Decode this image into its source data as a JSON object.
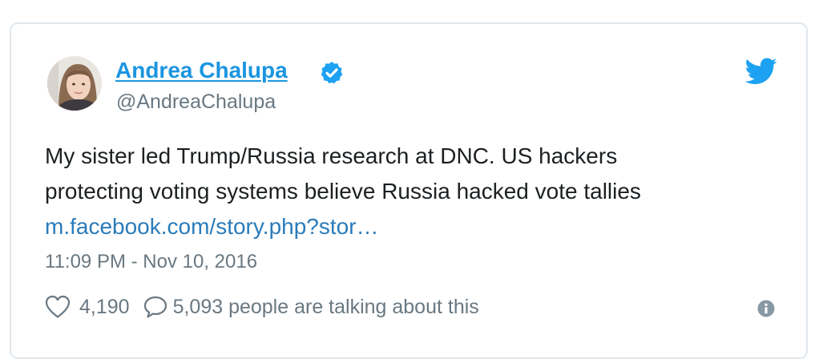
{
  "tweet": {
    "display_name": "Andrea Chalupa",
    "handle": "@AndreaChalupa",
    "text_line_1": "My sister led Trump/Russia research at DNC. US hackers",
    "text_line_2": "protecting voting systems believe Russia hacked vote tallies",
    "link_text": "m.facebook.com/story.php?stor…",
    "timestamp": "11:09 PM - Nov 10, 2016",
    "like_count": "4,190",
    "talking_text": "5,093 people are talking about this"
  },
  "icons": {
    "avatar": "profile-photo",
    "verified": "verified-badge-icon",
    "brand": "twitter-bird-icon",
    "like": "heart-icon",
    "reply": "speech-bubble-icon",
    "info": "info-icon"
  },
  "colors": {
    "accent": "#1b95e0",
    "link": "#2b7bb9",
    "text": "#1c2022",
    "muted": "#697882",
    "border": "#e1e8ed"
  }
}
